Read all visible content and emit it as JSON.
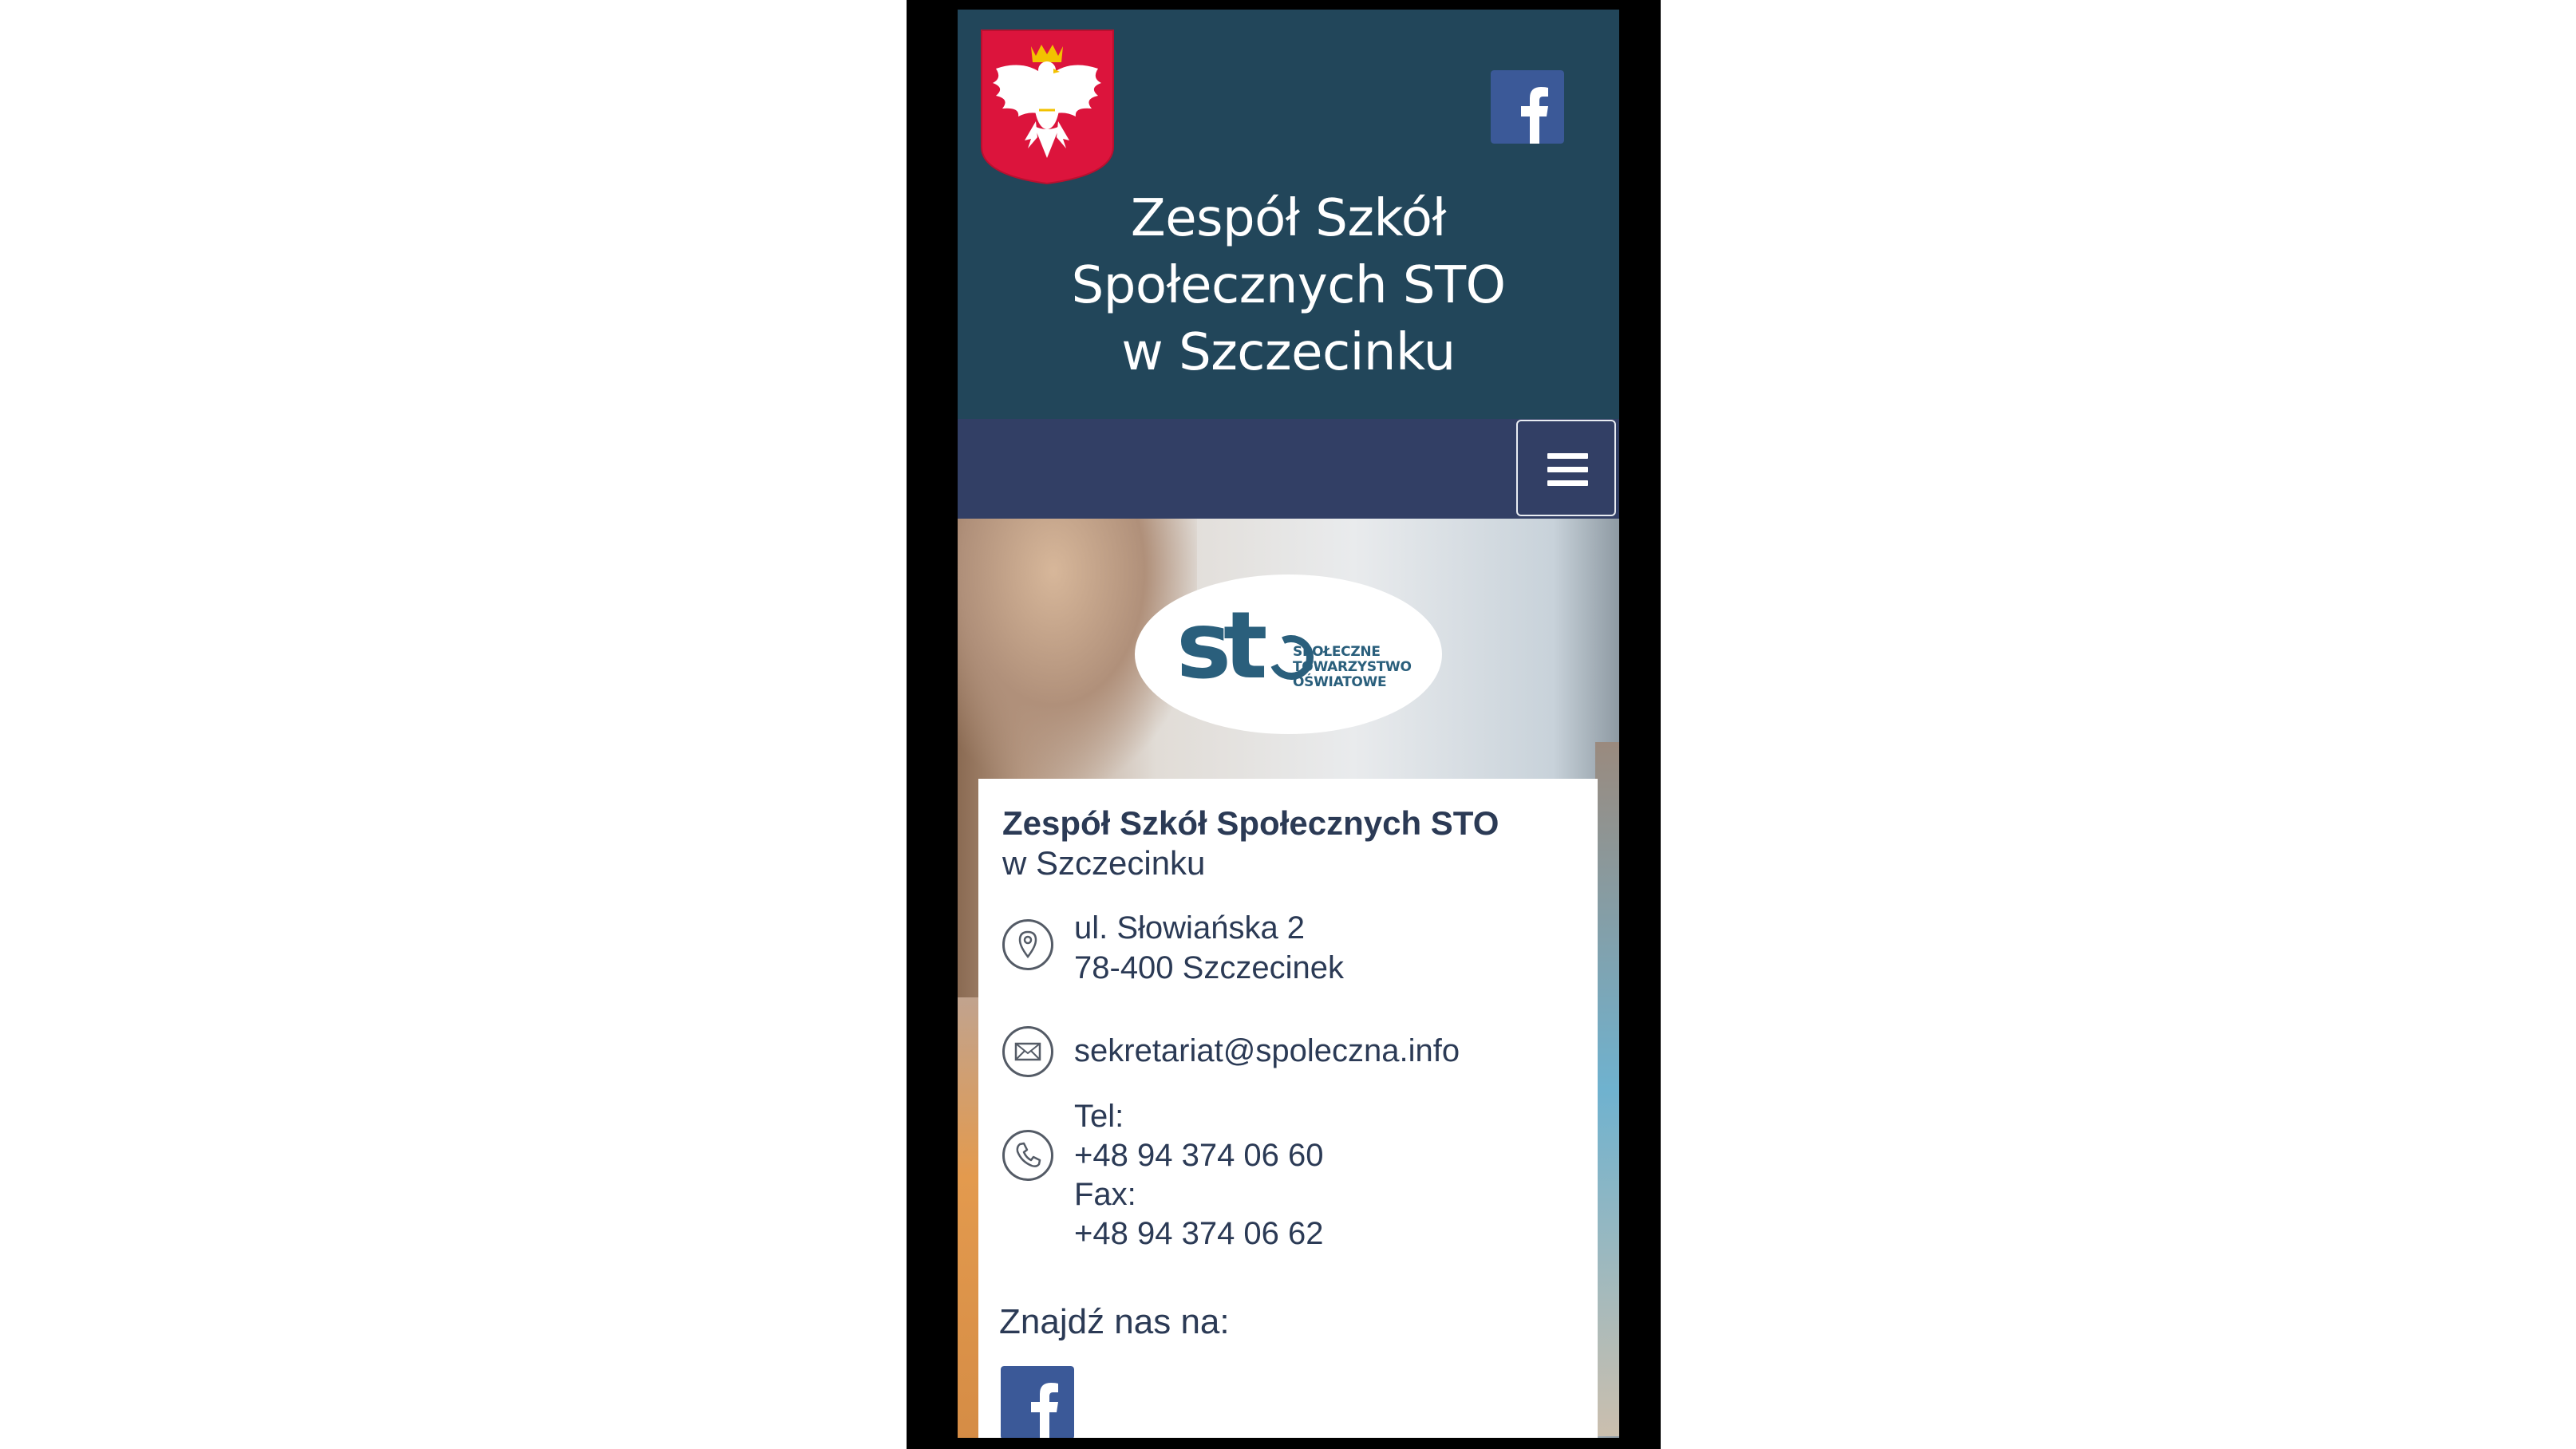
{
  "header": {
    "title_lines": [
      "Zespół Szkół",
      "Społecznych STO",
      "w Szczecinku"
    ],
    "emblem_icon": "polish-eagle-emblem-icon",
    "social_icon": "facebook-icon",
    "background_color": "#22465a"
  },
  "navbar": {
    "menu_icon": "hamburger-menu-icon",
    "background_color": "#323f65"
  },
  "hero": {
    "logo": {
      "mark": "st",
      "text_lines": [
        "SPOŁECZNE",
        "TOWARZYSTWO",
        "OŚWIATOWE"
      ]
    }
  },
  "contact": {
    "school_name": "Zespół Szkół Społecznych STO",
    "school_city": "w Szczecinku",
    "address_icon": "location-pin-icon",
    "address_line1": "ul. Słowiańska 2",
    "address_line2": "78-400 Szczecinek",
    "email_icon": "envelope-icon",
    "email": "sekretariat@spoleczna.info",
    "phone_icon": "phone-icon",
    "tel_label": "Tel:",
    "tel": "+48 94 374 06 60",
    "fax_label": "Fax:",
    "fax": "+48 94 374 06 62",
    "find_us_label": "Znajdź nas na:",
    "find_us_icon": "facebook-icon"
  },
  "colors": {
    "facebook_blue": "#3b5998",
    "text_dark": "#2b3a55",
    "logo_teal": "#2a5f7c"
  }
}
